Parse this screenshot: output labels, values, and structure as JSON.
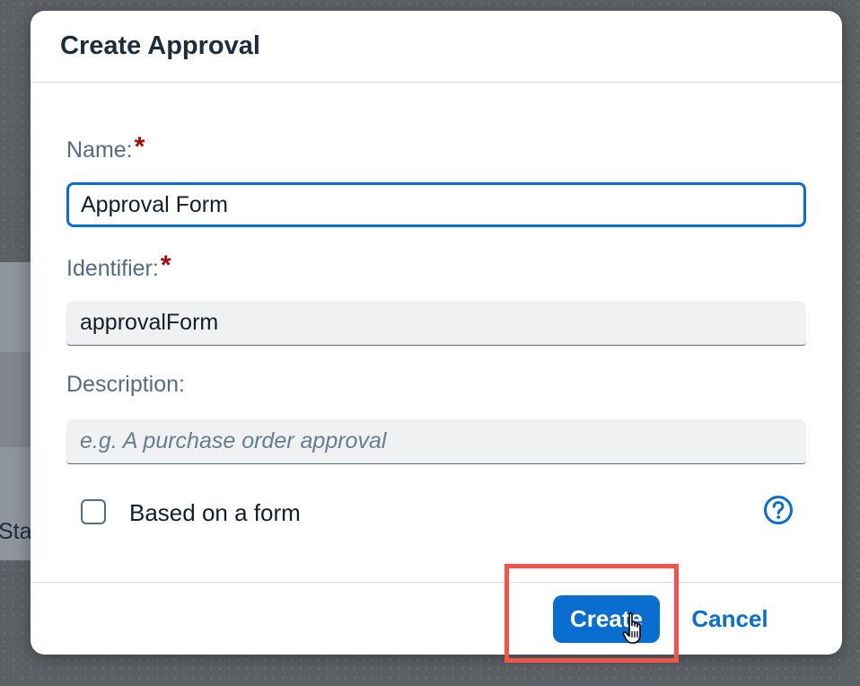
{
  "background": {
    "partial_text": "Sta"
  },
  "dialog": {
    "title": "Create Approval",
    "fields": {
      "name": {
        "label": "Name:",
        "required_marker": "*",
        "value": "Approval Form"
      },
      "identifier": {
        "label": "Identifier:",
        "required_marker": "*",
        "value": "approvalForm"
      },
      "description": {
        "label": "Description:",
        "value": "",
        "placeholder": "e.g. A purchase order approval"
      }
    },
    "checkbox": {
      "label": "Based on a form",
      "checked": false
    },
    "help_icon": "question-circle-icon",
    "buttons": {
      "create_label": "Create",
      "cancel_label": "Cancel"
    }
  },
  "colors": {
    "accent": "#0a6ed1",
    "required": "#aa0808",
    "highlight": "#f0544a",
    "title": "#1d2d3e",
    "label": "#556b82"
  }
}
